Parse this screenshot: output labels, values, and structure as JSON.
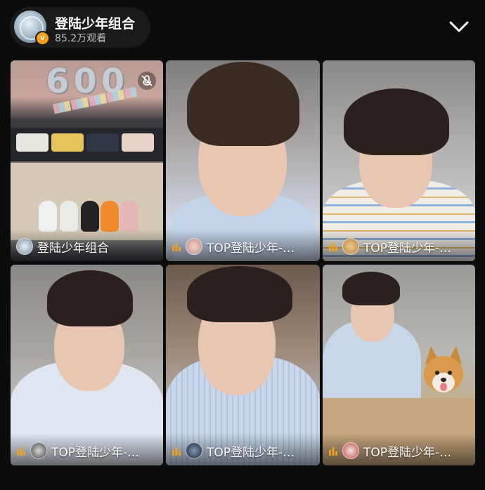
{
  "header": {
    "title": "登陆少年组合",
    "viewers": "85.2万观看",
    "avatar_icon": "globe-avatar",
    "verified_badge": "v",
    "collapse_icon": "chevron-down-icon"
  },
  "tiles": [
    {
      "caption": "登陆少年组合",
      "decor_text": "600",
      "icon": "group-avatar",
      "muted": true
    },
    {
      "caption": "TOP登陆少年-…",
      "icon": "member-avatar",
      "live": true
    },
    {
      "caption": "TOP登陆少年-…",
      "icon": "member-avatar",
      "live": true
    },
    {
      "caption": "TOP登陆少年-…",
      "icon": "member-avatar",
      "live": true
    },
    {
      "caption": "TOP登陆少年-…",
      "icon": "member-avatar",
      "live": true
    },
    {
      "caption": "TOP登陆少年-…",
      "icon": "member-avatar",
      "live": true
    }
  ],
  "colors": {
    "background": "#0c0c0c",
    "live_bars": "#f0a020",
    "badge": "#f7a11a"
  }
}
